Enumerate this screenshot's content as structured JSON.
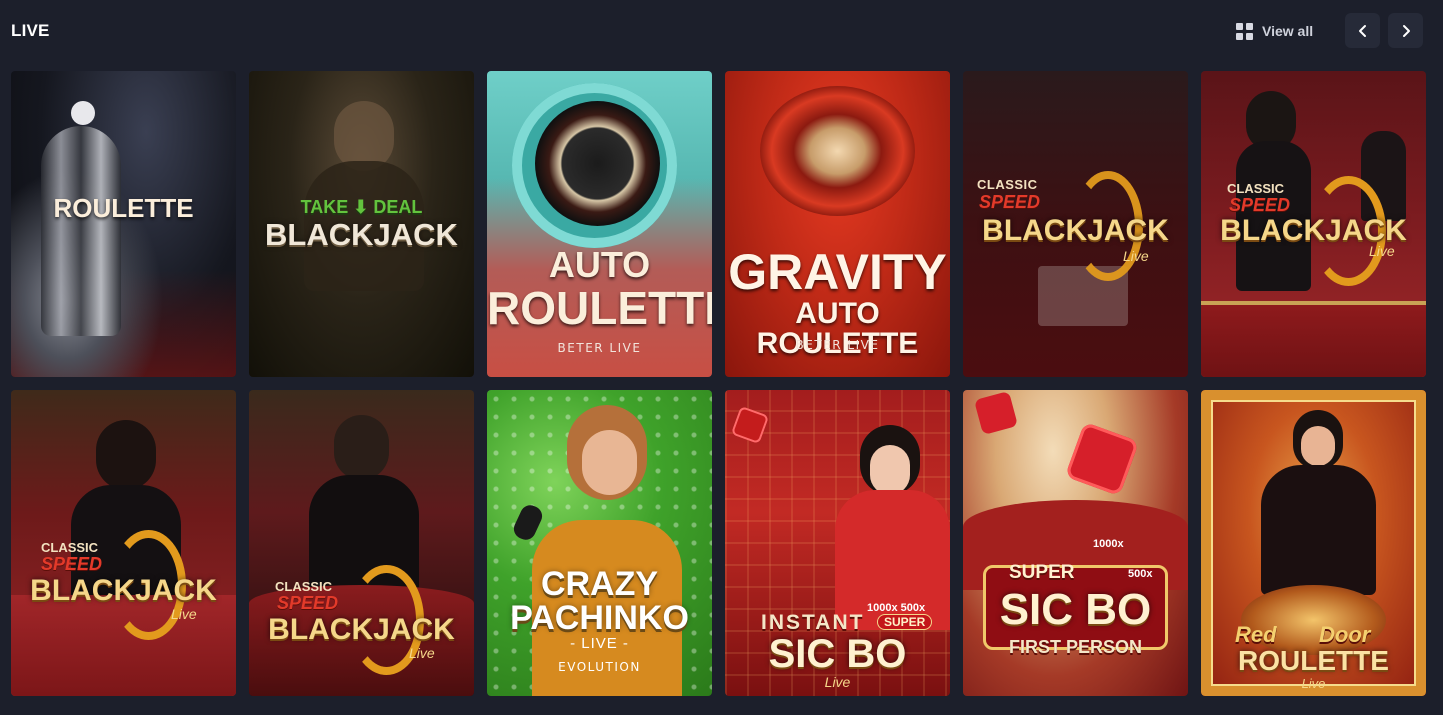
{
  "header": {
    "title": "LIVE",
    "view_all_label": "View all"
  },
  "colors": {
    "background": "#1c1f2b",
    "nav_button": "#262a38",
    "text_muted": "#cfd2dc"
  },
  "tiles": [
    {
      "line1": "ROULETTE"
    },
    {
      "line1": "TAKE",
      "line1b": "DEAL",
      "line2": "BLACKJACK"
    },
    {
      "line1": "AUTO",
      "line2": "ROULETTE",
      "provider": "BETER LIVE"
    },
    {
      "line1": "GRAVITY",
      "line2": "AUTO ROULETTE",
      "provider": "BETER LIVE"
    },
    {
      "line0": "CLASSIC",
      "line1": "SPEED",
      "line2": "BLACKJACK",
      "line3": "Live"
    },
    {
      "line0": "CLASSIC",
      "line1": "SPEED",
      "line2": "BLACKJACK",
      "line3": "Live"
    },
    {
      "line0": "CLASSIC",
      "line1": "SPEED",
      "line2": "BLACKJACK",
      "line3": "Live"
    },
    {
      "line0": "CLASSIC",
      "line1": "SPEED",
      "line2": "BLACKJACK",
      "line3": "Live"
    },
    {
      "line1": "CRAZY",
      "line2": "PACHINKO",
      "line3": "- LIVE -",
      "provider": "EVOLUTION"
    },
    {
      "line0": "1000x 500x",
      "line0b": "SUPER",
      "line1": "INSTANT",
      "line2": "SIC BO",
      "line3": "Live"
    },
    {
      "line0": "1000x",
      "line0b": "500x",
      "line1": "SUPER",
      "line2": "SIC BO",
      "line3": "FIRST PERSON"
    },
    {
      "line1": "Red",
      "line1b": "Door",
      "line2": "ROULETTE",
      "line3": "Live"
    }
  ]
}
